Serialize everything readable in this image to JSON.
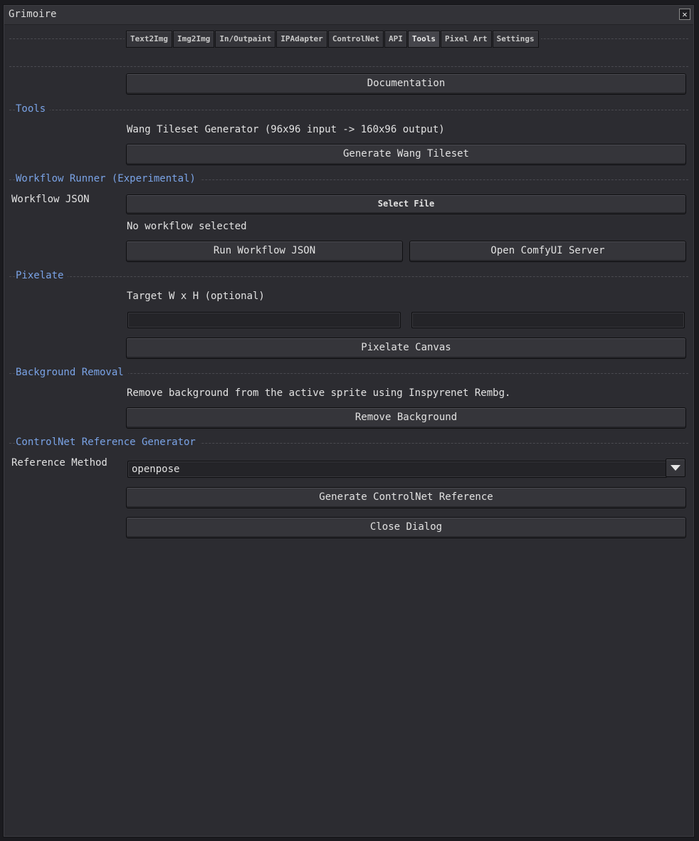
{
  "window": {
    "title": "Grimoire",
    "close_glyph": "✕"
  },
  "tabs": [
    {
      "label": "Text2Img",
      "active": false
    },
    {
      "label": "Img2Img",
      "active": false
    },
    {
      "label": "In/Outpaint",
      "active": false
    },
    {
      "label": "IPAdapter",
      "active": false
    },
    {
      "label": "ControlNet",
      "active": false
    },
    {
      "label": "API",
      "active": false
    },
    {
      "label": "Tools",
      "active": true
    },
    {
      "label": "Pixel Art",
      "active": false
    },
    {
      "label": "Settings",
      "active": false
    }
  ],
  "documentation_button": "Documentation",
  "tools": {
    "heading": "Tools",
    "wang_description": "Wang Tileset Generator (96x96 input -> 160x96 output)",
    "wang_button": "Generate Wang Tileset"
  },
  "workflow": {
    "heading": "Workflow Runner (Experimental)",
    "json_label": "Workflow JSON",
    "select_file_button": "Select File",
    "status": "No workflow selected",
    "run_button": "Run Workflow JSON",
    "open_server_button": "Open ComfyUI Server"
  },
  "pixelate": {
    "heading": "Pixelate",
    "target_label": "Target W x H (optional)",
    "width_value": "",
    "height_value": "",
    "button": "Pixelate Canvas"
  },
  "background_removal": {
    "heading": "Background Removal",
    "description": "Remove background from the active sprite using Inspyrenet Rembg.",
    "button": "Remove Background"
  },
  "controlnet_ref": {
    "heading": "ControlNet Reference Generator",
    "method_label": "Reference Method",
    "method_value": "openpose",
    "generate_button": "Generate ControlNet Reference"
  },
  "close_dialog_button": "Close Dialog"
}
